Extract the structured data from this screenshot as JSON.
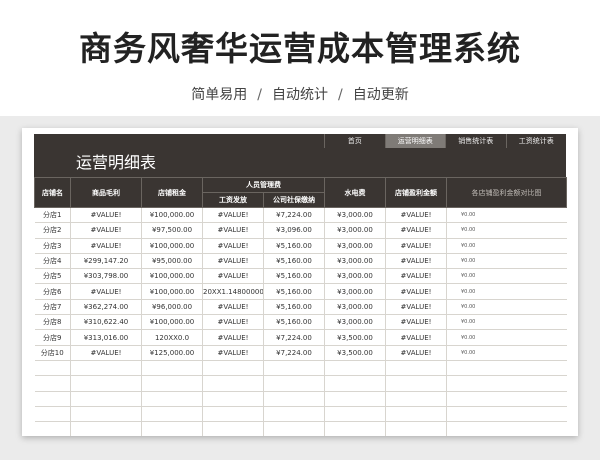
{
  "title": "商务风奢华运营成本管理系统",
  "subtitle": [
    "简单易用",
    "自动统计",
    "自动更新"
  ],
  "sheet": {
    "title": "运营明细表",
    "nav": [
      {
        "label": "首页",
        "active": false
      },
      {
        "label": "运营明细表",
        "active": true
      },
      {
        "label": "销售统计表",
        "active": false
      },
      {
        "label": "工资统计表",
        "active": false
      }
    ]
  },
  "table": {
    "headers": {
      "store": "店铺名",
      "gross": "商品毛利",
      "rent": "店铺租金",
      "staff_group": "人员管理费",
      "wage": "工资发放",
      "social": "公司社保缴纳",
      "utility": "水电费",
      "profit": "店铺盈利金额",
      "chart": "各店铺盈利金额对比图"
    },
    "rows": [
      {
        "store": "分店1",
        "gross": "#VALUE!",
        "rent": "¥100,000.00",
        "wage": "#VALUE!",
        "social": "¥7,224.00",
        "utility": "¥3,000.00",
        "profit": "#VALUE!",
        "chart": "¥0.00"
      },
      {
        "store": "分店2",
        "gross": "#VALUE!",
        "rent": "¥97,500.00",
        "wage": "#VALUE!",
        "social": "¥3,096.00",
        "utility": "¥3,000.00",
        "profit": "#VALUE!",
        "chart": "¥0.00"
      },
      {
        "store": "分店3",
        "gross": "#VALUE!",
        "rent": "¥100,000.00",
        "wage": "#VALUE!",
        "social": "¥5,160.00",
        "utility": "¥3,000.00",
        "profit": "#VALUE!",
        "chart": "¥0.00"
      },
      {
        "store": "分店4",
        "gross": "¥299,147.20",
        "rent": "¥95,000.00",
        "wage": "#VALUE!",
        "social": "¥5,160.00",
        "utility": "¥3,000.00",
        "profit": "#VALUE!",
        "chart": "¥0.00"
      },
      {
        "store": "分店5",
        "gross": "¥303,798.00",
        "rent": "¥100,000.00",
        "wage": "#VALUE!",
        "social": "¥5,160.00",
        "utility": "¥3,000.00",
        "profit": "#VALUE!",
        "chart": "¥0.00"
      },
      {
        "store": "分店6",
        "gross": "#VALUE!",
        "rent": "¥100,000.00",
        "wage": "20XX1.148000000(",
        "social": "¥5,160.00",
        "utility": "¥3,000.00",
        "profit": "#VALUE!",
        "chart": "¥0.00"
      },
      {
        "store": "分店7",
        "gross": "¥362,274.00",
        "rent": "¥96,000.00",
        "wage": "#VALUE!",
        "social": "¥5,160.00",
        "utility": "¥3,000.00",
        "profit": "#VALUE!",
        "chart": "¥0.00"
      },
      {
        "store": "分店8",
        "gross": "¥310,622.40",
        "rent": "¥100,000.00",
        "wage": "#VALUE!",
        "social": "¥5,160.00",
        "utility": "¥3,000.00",
        "profit": "#VALUE!",
        "chart": "¥0.00"
      },
      {
        "store": "分店9",
        "gross": "¥313,016.00",
        "rent": "120XX0.0",
        "wage": "#VALUE!",
        "social": "¥7,224.00",
        "utility": "¥3,500.00",
        "profit": "#VALUE!",
        "chart": "¥0.00"
      },
      {
        "store": "分店10",
        "gross": "#VALUE!",
        "rent": "¥125,000.00",
        "wage": "#VALUE!",
        "social": "¥7,224.00",
        "utility": "¥3,500.00",
        "profit": "#VALUE!",
        "chart": "¥0.00"
      }
    ]
  }
}
